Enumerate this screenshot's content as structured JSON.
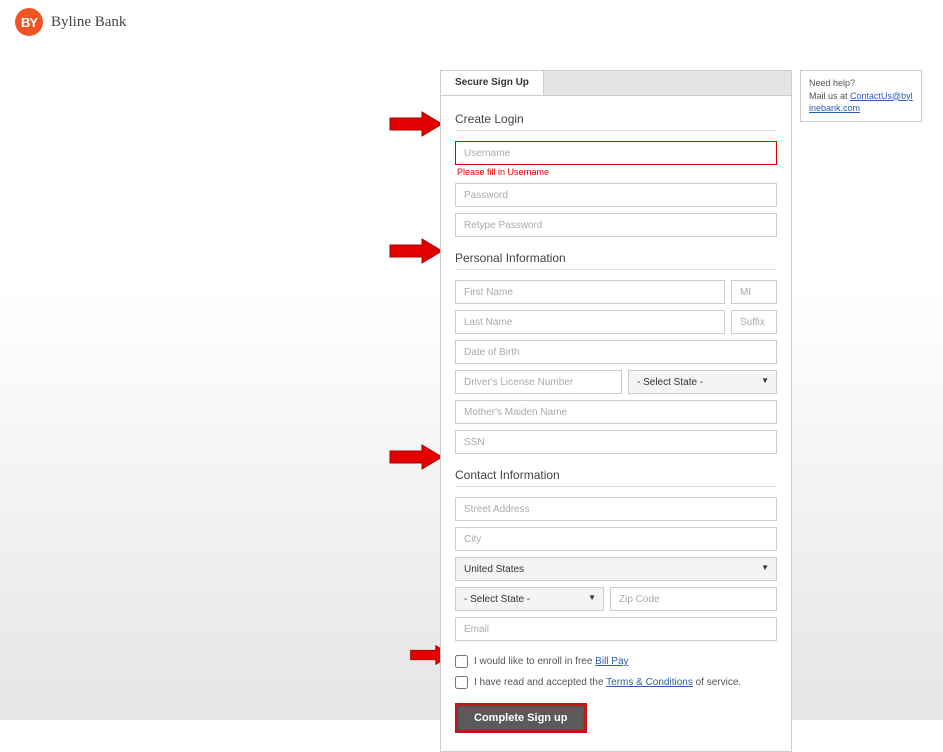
{
  "brand": {
    "logo_initials": "BY",
    "name": "Byline Bank"
  },
  "help": {
    "title": "Need help?",
    "prefix": "Mail us at ",
    "email": "ContactUs@bylinebank.com"
  },
  "tab": {
    "label": "Secure Sign Up"
  },
  "sections": {
    "login": {
      "heading": "Create Login"
    },
    "personal": {
      "heading": "Personal Information"
    },
    "contact": {
      "heading": "Contact Information"
    }
  },
  "fields": {
    "username": {
      "placeholder": "Username",
      "error": "Please fill in Username"
    },
    "password": {
      "placeholder": "Password"
    },
    "retype": {
      "placeholder": "Retype Password"
    },
    "first": {
      "placeholder": "First Name"
    },
    "mi": {
      "placeholder": "MI"
    },
    "last": {
      "placeholder": "Last Name"
    },
    "suffix": {
      "placeholder": "Suffix"
    },
    "dob": {
      "placeholder": "Date of Birth"
    },
    "dl": {
      "placeholder": "Driver's License Number"
    },
    "dl_state": {
      "selected": "- Select State -"
    },
    "mmn": {
      "placeholder": "Mother's Maiden Name"
    },
    "ssn": {
      "placeholder": "SSN"
    },
    "street": {
      "placeholder": "Street Address"
    },
    "city": {
      "placeholder": "City"
    },
    "country": {
      "selected": "United States"
    },
    "state": {
      "selected": "- Select State -"
    },
    "zip": {
      "placeholder": "Zip Code"
    },
    "email": {
      "placeholder": "Email"
    }
  },
  "checks": {
    "billpay": {
      "prefix": "I would like to enroll in free ",
      "link": "Bill Pay"
    },
    "terms": {
      "prefix": "I have read and accepted the ",
      "link": "Terms & Conditions",
      "suffix": " of service."
    }
  },
  "submit": {
    "label": "Complete Sign up"
  }
}
